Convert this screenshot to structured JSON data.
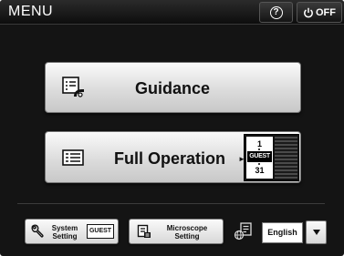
{
  "header": {
    "title": "MENU",
    "help_icon": "question-circle-icon",
    "off_icon": "power-icon",
    "off_label": "OFF"
  },
  "main": {
    "guidance_label": "Guidance",
    "guidance_icon": "guidance-document-icon",
    "full_operation_label": "Full Operation",
    "full_operation_icon": "list-document-icon",
    "user_selector": {
      "top_value": "1",
      "selected": "GUEST",
      "bottom_value": "31"
    }
  },
  "footer": {
    "system_setting_label": "System Setting",
    "system_setting_icon": "wrench-icon",
    "guest_badge": "GUEST",
    "microscope_setting_label": "Microscope Setting",
    "microscope_setting_icon": "microscope-icon",
    "language_icon": "globe-document-icon",
    "language_value": "English",
    "dropdown_icon": "triangle-down-icon"
  },
  "colors": {
    "background": "#141414",
    "button_face": "#e6e6e6",
    "text_dark": "#111111",
    "text_light": "#ffffff"
  }
}
